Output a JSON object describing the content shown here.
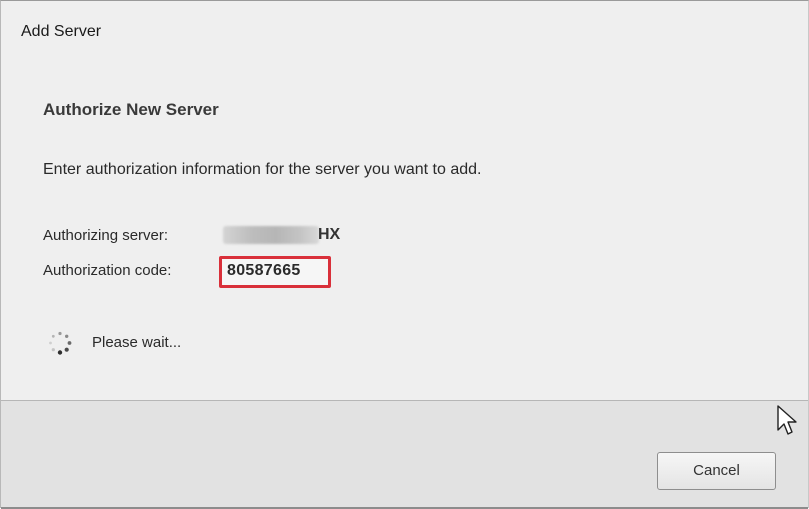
{
  "window": {
    "title": "Add Server"
  },
  "main": {
    "heading": "Authorize New Server",
    "instruction": "Enter authorization information for the server you want to add.",
    "server_label": "Authorizing server:",
    "server_value_suffix": "HX",
    "code_label": "Authorization code:",
    "code_value": "80587665",
    "status_text": "Please wait...",
    "highlight_color": "#d9303a"
  },
  "footer": {
    "cancel_label": "Cancel"
  },
  "icons": {
    "spinner": "loading-spinner-icon",
    "cursor": "mouse-pointer-icon"
  }
}
